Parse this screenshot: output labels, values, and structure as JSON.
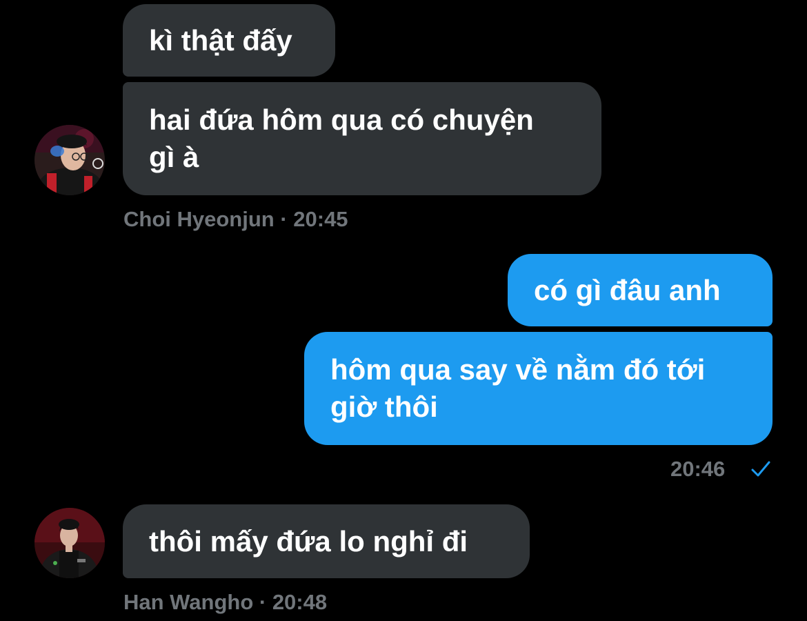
{
  "colors": {
    "background": "#000000",
    "incoming_bubble": "#2f3336",
    "outgoing_bubble": "#1d9bf0",
    "meta_text": "#71767b",
    "read_check": "#1d9bf0"
  },
  "messages": [
    {
      "direction": "incoming",
      "text": "kì thật đấy"
    },
    {
      "direction": "incoming",
      "text": "hai đứa hôm qua có chuyện\ngì à"
    },
    {
      "direction": "outgoing",
      "text": "có gì đâu anh"
    },
    {
      "direction": "outgoing",
      "text": "hôm qua say về nằm đó tới\ngiờ thôi"
    },
    {
      "direction": "incoming",
      "text": "thôi mấy đứa lo nghỉ đi"
    }
  ],
  "meta": {
    "group1": {
      "sender": "Choi Hyeonjun",
      "separator": "·",
      "time": "20:45",
      "label": "Choi Hyeonjun · 20:45"
    },
    "group2": {
      "time": "20:46",
      "status_icon": "check-icon"
    },
    "group3": {
      "sender": "Han Wangho",
      "separator": "·",
      "time": "20:48",
      "label": "Han Wangho · 20:48"
    }
  },
  "avatars": [
    {
      "name": "avatar-choi-hyeonjun",
      "icon": "user-photo"
    },
    {
      "name": "avatar-han-wangho",
      "icon": "user-photo"
    }
  ]
}
